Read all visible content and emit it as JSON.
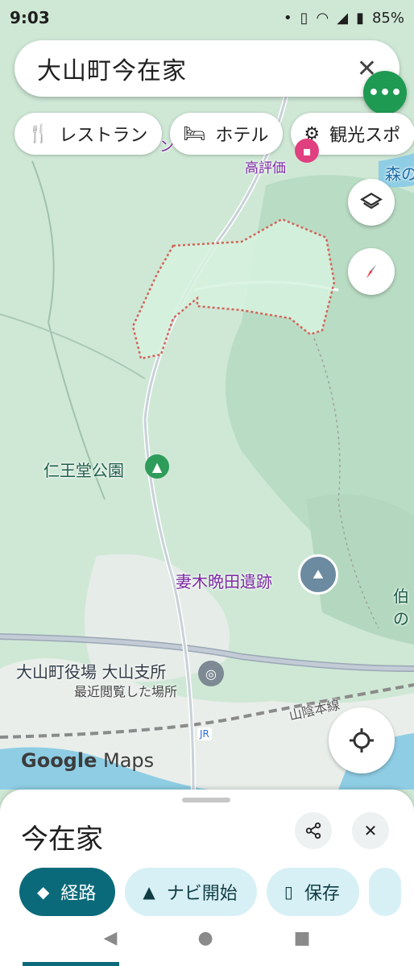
{
  "status": {
    "time": "9:03",
    "battery": "85%"
  },
  "search": {
    "query": "大山町今在家"
  },
  "chips": [
    {
      "icon": "utensils-icon",
      "label": "レストラン"
    },
    {
      "icon": "bed-icon",
      "label": "ホテル"
    },
    {
      "icon": "camera-icon",
      "label": "観光スポ"
    }
  ],
  "map": {
    "labels": {
      "park": "仁王堂公園",
      "ruins": "妻木晩田遺跡",
      "office_name": "大山町役場 大山支所",
      "office_sub": "最近閲覧した場所",
      "railway": "山陰本線",
      "hotel_rating": "高評価",
      "forest_partial": "森の",
      "edge_partial_1": "伯",
      "edge_partial_2": "の",
      "hotel_partial": "ン",
      "jr": "JR"
    },
    "logo_google": "Google",
    "logo_maps": "Maps"
  },
  "sheet": {
    "title": "今在家",
    "actions": [
      {
        "icon": "directions-icon",
        "label": "経路"
      },
      {
        "icon": "navigation-arrow-icon",
        "label": "ナビ開始"
      },
      {
        "icon": "bookmark-icon",
        "label": "保存"
      }
    ]
  },
  "colors": {
    "map_bg": "#cfe8d6",
    "boundary": "#d4655a",
    "primary_action": "#0b6a7a",
    "fab_green": "#1e9a52"
  }
}
